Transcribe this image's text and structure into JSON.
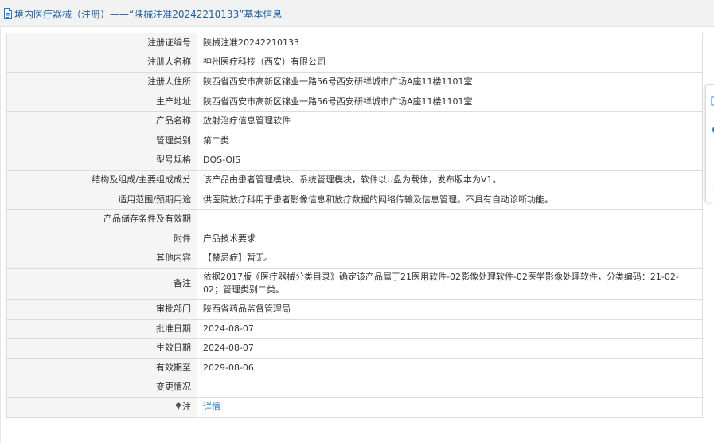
{
  "header": {
    "title": "境内医疗器械（注册）——“陕械注准20242210133”基本信息"
  },
  "rows": [
    {
      "label": "注册证编号",
      "value": "陕械注准20242210133"
    },
    {
      "label": "注册人名称",
      "value": "神州医疗科技（西安）有限公司"
    },
    {
      "label": "注册人住所",
      "value": "陕西省西安市高新区锦业一路56号西安研祥城市广场A座11楼1101室"
    },
    {
      "label": "生产地址",
      "value": "陕西省西安市高新区锦业一路56号西安研祥城市广场A座11楼1101室"
    },
    {
      "label": "产品名称",
      "value": "放射治疗信息管理软件"
    },
    {
      "label": "管理类别",
      "value": "第二类"
    },
    {
      "label": "型号规格",
      "value": "DOS-OIS"
    },
    {
      "label": "结构及组成/主要组成成分",
      "value": "该产品由患者管理模块、系统管理模块，软件以U盘为载体，发布版本为V1。"
    },
    {
      "label": "适用范围/预期用途",
      "value": "供医院放疗科用于患者影像信息和放疗数据的网络传输及信息管理。不具有自动诊断功能。"
    },
    {
      "label": "产品储存条件及有效期",
      "value": ""
    },
    {
      "label": "附件",
      "value": "产品技术要求"
    },
    {
      "label": "其他内容",
      "value": "【禁忌症】暂无。"
    },
    {
      "label": "备注",
      "value": "依据2017版《医疗器械分类目录》确定该产品属于21医用软件-02影像处理软件-02医学影像处理软件，分类编码：21-02-02；管理类别二类。"
    },
    {
      "label": "审批部门",
      "value": "陕西省药品监督管理局"
    },
    {
      "label": "批准日期",
      "value": "2024-08-07"
    },
    {
      "label": "生效日期",
      "value": "2024-08-07"
    },
    {
      "label": "有效期至",
      "value": "2029-08-06"
    },
    {
      "label": "变更情况",
      "value": ""
    }
  ],
  "note": {
    "label": "注",
    "link_text": "详情"
  },
  "icons": {
    "header": "document-icon",
    "note": "pin-icon"
  },
  "colors": {
    "accent": "#2a77c9",
    "header_text": "#1f5f9e",
    "label_bg": "#f5f5f5",
    "border": "#dcdcdc"
  }
}
